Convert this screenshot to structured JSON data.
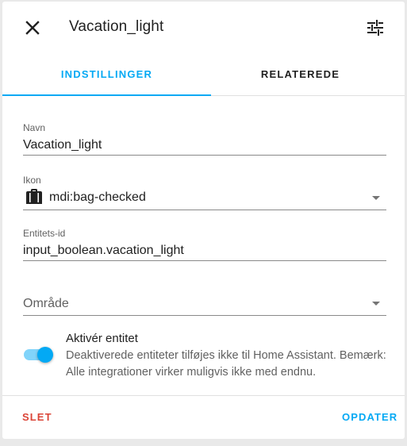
{
  "dialog": {
    "title": "Vacation_light"
  },
  "header": {
    "close_icon": "close-icon",
    "settings_icon": "tune-icon"
  },
  "tabs": [
    {
      "label": "INDSTILLINGER",
      "active": true
    },
    {
      "label": "RELATEREDE",
      "active": false
    }
  ],
  "fields": {
    "name": {
      "label": "Navn",
      "value": "Vacation_light"
    },
    "icon": {
      "label": "Ikon",
      "value": "mdi:bag-checked",
      "icon": "bag-checked-icon"
    },
    "entity_id": {
      "label": "Entitets-id",
      "value": "input_boolean.vacation_light"
    },
    "area": {
      "placeholder": "Område",
      "value": ""
    }
  },
  "enable_entity": {
    "title": "Aktivér entitet",
    "description": "Deaktiverede entiteter tilføjes ikke til Home Assistant. Bemærk: Alle integrationer virker muligvis ikke med endnu.",
    "enabled": true
  },
  "footer": {
    "delete_label": "SLET",
    "update_label": "OPDATER"
  },
  "colors": {
    "accent": "#03a9f4",
    "danger": "#db4437"
  }
}
